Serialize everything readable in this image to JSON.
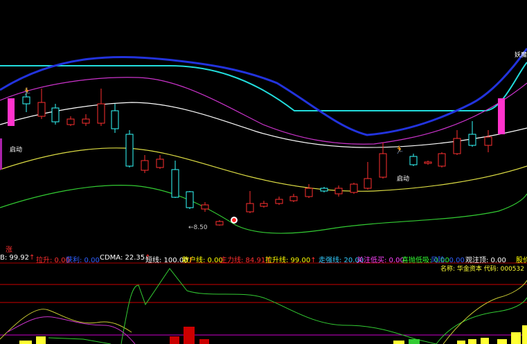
{
  "main_chart": {
    "ma_labels": {
      "start_left": "启动",
      "start_right": "启动",
      "demon": "妖魔"
    },
    "low_price_marker": "←8.50",
    "zhang_marker": "涨"
  },
  "indicator_bar": {
    "items": [
      {
        "label": "B: 99.92",
        "arrow": "↑",
        "color": "#ffffff"
      },
      {
        "label": "拉升: 0.00",
        "arrow": "",
        "color": "#ff3030"
      },
      {
        "label": "获利: 0.00",
        "arrow": "",
        "color": "#3060ff"
      },
      {
        "label": "CDMA: 22.35",
        "arrow": "↑",
        "color": "#ffffff"
      },
      {
        "label": "短线: 100.00",
        "arrow": "↑",
        "color": "#ffffff"
      },
      {
        "label": "散户线: 0.00",
        "arrow": "",
        "color": "#ffff00"
      },
      {
        "label": "主力线: 84.91",
        "arrow": "↑",
        "color": "#ff3030"
      },
      {
        "label": "拉升线: 99.00",
        "arrow": "↑",
        "color": "#ffff00"
      },
      {
        "label": "走强线: 20.00",
        "arrow": "",
        "color": "#33ccff"
      },
      {
        "label": "关注低买: 0.00",
        "arrow": "",
        "color": "#ff44ff"
      },
      {
        "label": "喜抛低吸: 0.00",
        "arrow": "",
        "color": "#33ff33"
      },
      {
        "label": "风险: 0.00",
        "arrow": "",
        "color": "#3060ff"
      },
      {
        "label": "观注顶: 0.00",
        "arrow": "",
        "color": "#ffffff"
      },
      {
        "label": "股价",
        "arrow": "",
        "color": "#ffff00"
      }
    ],
    "stock_info": "名称: 华金资本 代码: 000532"
  },
  "colors": {
    "up": "#ff3030",
    "down": "#33ffff",
    "white": "#ffffff",
    "magenta": "#ff33ff",
    "yellow": "#ffff33",
    "green": "#33cc33",
    "cyan": "#22dddd",
    "blue": "#2233dd"
  }
}
